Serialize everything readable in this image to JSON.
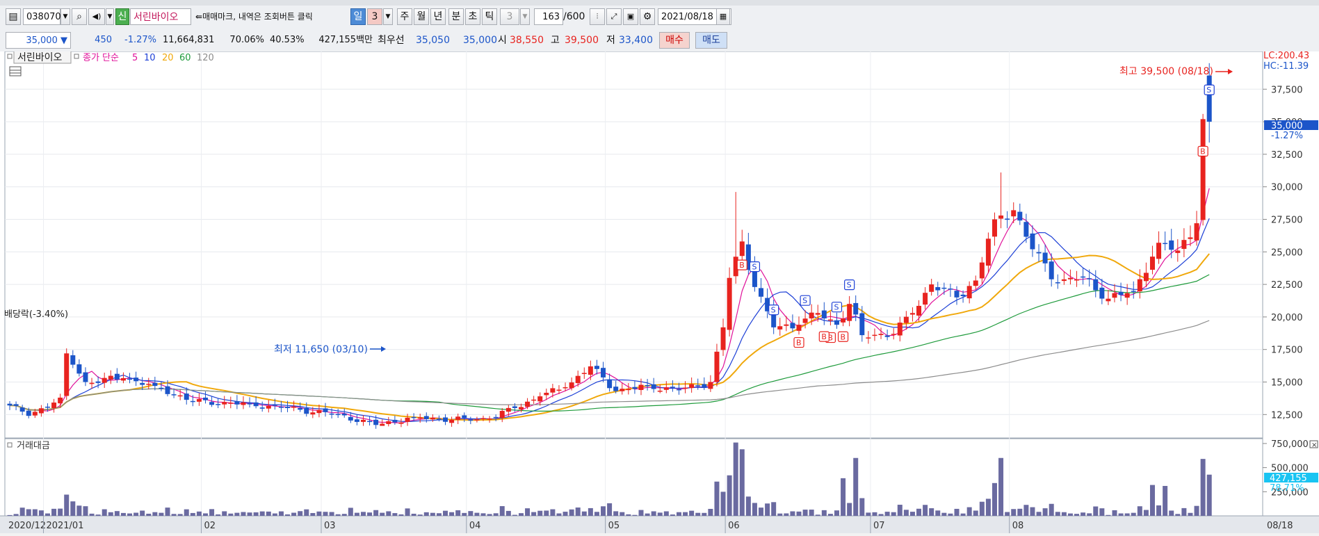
{
  "toolbar": {
    "code": "038070",
    "badge": "신",
    "stock_name": "서린바이오",
    "note": "매매마크, 내역은 조회버튼 클릭",
    "periods": [
      "일",
      "3",
      "주",
      "월",
      "년",
      "분",
      "초",
      "틱",
      "3"
    ],
    "count": "163",
    "count_total": "/600",
    "date": "2021/08/18"
  },
  "quote": {
    "price": "35,000",
    "change": "450",
    "change_pct": "-1.27%",
    "volume": "11,664,831",
    "ratio1": "70.06%",
    "ratio2": "40.53%",
    "amount": "427,155백만",
    "best_label": "최우선",
    "best_ask": "35,050",
    "best_bid": "35,000",
    "open_label": "시",
    "open": "38,550",
    "high_label": "고",
    "high": "39,500",
    "low_label": "저",
    "low": "33,400",
    "buy_label": "매수",
    "sell_label": "매도"
  },
  "legend": {
    "stock": "서린바이오",
    "ma_title": "종가 단순",
    "ma5": "5",
    "ma10": "10",
    "ma20": "20",
    "ma60": "60",
    "ma120": "120",
    "volume_title": "거래대금"
  },
  "annotations": {
    "high": "최고 39,500 (08/18)",
    "low": "최저 11,650 (03/10)",
    "dividend": "배당락(-3.40%)",
    "lc": "LC:200.43",
    "hc": "HC:-11.39",
    "last_price": "35,000",
    "last_pct": "-1.27%",
    "vol_last": "427,155",
    "vol_pct": "78.71%"
  },
  "colors": {
    "up": "#e8231f",
    "down": "#1c55c9",
    "ma5": "#e0129a",
    "ma10": "#1c3fd6",
    "ma20": "#f0a80b",
    "ma60": "#1d9a3a",
    "ma120": "#8c8c8c",
    "volume": "#6a6aa0"
  },
  "chart_data": {
    "type": "candlestick",
    "y_ticks": [
      12500,
      15000,
      17500,
      20000,
      22500,
      25000,
      27500,
      30000,
      32500,
      35000,
      37500
    ],
    "ylim": [
      10700,
      40400
    ],
    "volume_ticks": [
      250000,
      500000,
      750000
    ],
    "volume_ylim": [
      0,
      800000
    ],
    "x_labels": [
      "2020/12",
      "2021/01",
      "02",
      "03",
      "04",
      "05",
      "06",
      "07",
      "08",
      "08/18"
    ],
    "anchors": [
      {
        "i": 0,
        "c": 13200
      },
      {
        "i": 3,
        "c": 12400
      },
      {
        "i": 8,
        "c": 13800
      },
      {
        "i": 9,
        "c": 17200
      },
      {
        "i": 12,
        "c": 15000
      },
      {
        "i": 18,
        "c": 15300
      },
      {
        "i": 23,
        "c": 14700
      },
      {
        "i": 29,
        "c": 13500
      },
      {
        "i": 38,
        "c": 13300
      },
      {
        "i": 44,
        "c": 13000
      },
      {
        "i": 52,
        "c": 12500
      },
      {
        "i": 58,
        "c": 11700
      },
      {
        "i": 64,
        "c": 12300
      },
      {
        "i": 70,
        "c": 12100
      },
      {
        "i": 76,
        "c": 12200
      },
      {
        "i": 80,
        "c": 13000
      },
      {
        "i": 84,
        "c": 13900
      },
      {
        "i": 88,
        "c": 14600
      },
      {
        "i": 92,
        "c": 16200
      },
      {
        "i": 96,
        "c": 14300
      },
      {
        "i": 101,
        "c": 14700
      },
      {
        "i": 106,
        "c": 14400
      },
      {
        "i": 111,
        "c": 15000
      },
      {
        "i": 113,
        "c": 19200
      },
      {
        "i": 114,
        "c": 23000
      },
      {
        "i": 116,
        "c": 25800
      },
      {
        "i": 118,
        "c": 22300
      },
      {
        "i": 121,
        "c": 19200
      },
      {
        "i": 125,
        "c": 19400
      },
      {
        "i": 128,
        "c": 20300
      },
      {
        "i": 131,
        "c": 19400
      },
      {
        "i": 133,
        "c": 21000
      },
      {
        "i": 135,
        "c": 18600
      },
      {
        "i": 140,
        "c": 18700
      },
      {
        "i": 143,
        "c": 20300
      },
      {
        "i": 146,
        "c": 22500
      },
      {
        "i": 150,
        "c": 21500
      },
      {
        "i": 153,
        "c": 22800
      },
      {
        "i": 156,
        "c": 27500
      },
      {
        "i": 159,
        "c": 28200
      },
      {
        "i": 162,
        "c": 25200
      },
      {
        "i": 166,
        "c": 22600
      },
      {
        "i": 170,
        "c": 23100
      },
      {
        "i": 174,
        "c": 21400
      },
      {
        "i": 178,
        "c": 22000
      },
      {
        "i": 182,
        "c": 25700
      },
      {
        "i": 185,
        "c": 25100
      },
      {
        "i": 188,
        "c": 27200
      },
      {
        "i": 189,
        "c": 35200
      },
      {
        "i": 190,
        "c": 35000
      }
    ],
    "high_point": {
      "i": 190,
      "value": 39500,
      "date": "08/18"
    },
    "low_point": {
      "i": 59,
      "value": 11650,
      "date": "03/10"
    }
  }
}
